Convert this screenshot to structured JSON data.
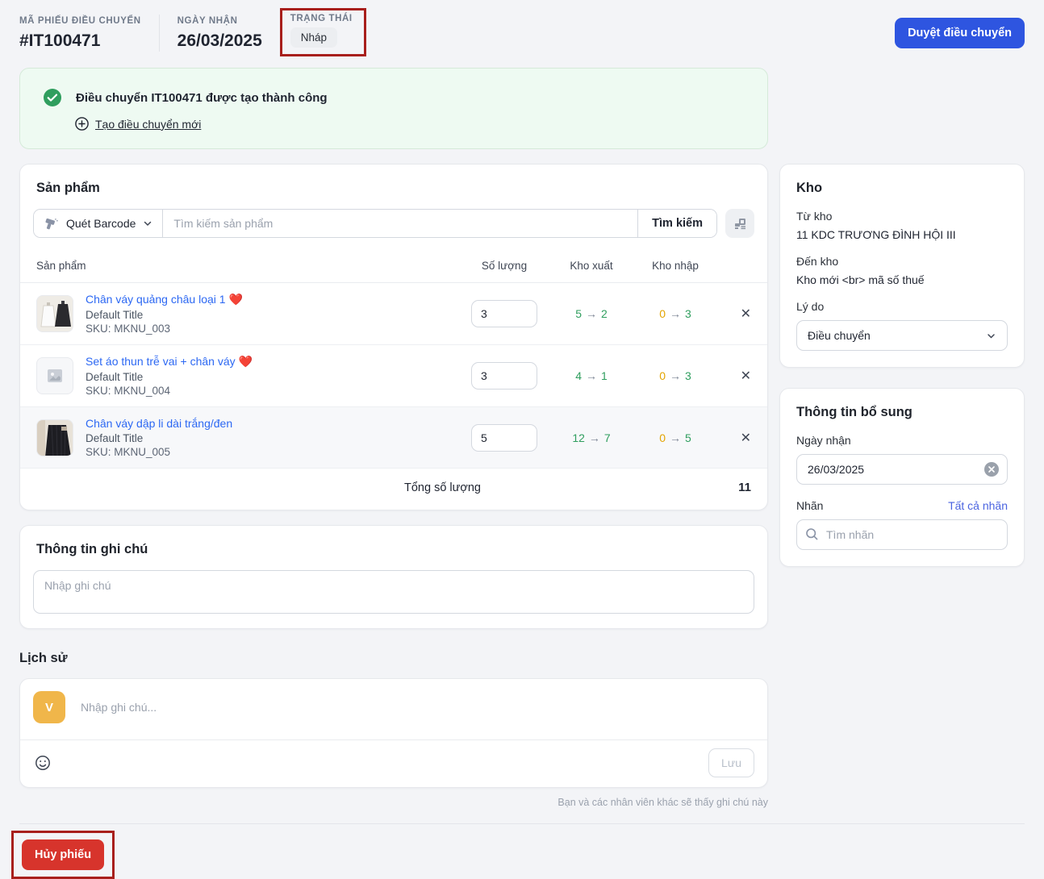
{
  "header": {
    "code_label": "MÃ PHIẾU ĐIỀU CHUYỂN",
    "code_value": "#IT100471",
    "date_label": "NGÀY NHẬN",
    "date_value": "26/03/2025",
    "status_label": "TRẠNG THÁI",
    "status_value": "Nháp",
    "approve_button": "Duyệt điều chuyển"
  },
  "banner": {
    "title": "Điều chuyển IT100471 được tạo thành công",
    "link": "Tạo điều chuyển mới"
  },
  "products": {
    "title": "Sản phẩm",
    "barcode_button": "Quét Barcode",
    "search_placeholder": "Tìm kiếm sản phẩm",
    "search_button": "Tìm kiếm",
    "columns": {
      "product": "Sản phẩm",
      "quantity": "Số lượng",
      "out_stock": "Kho xuất",
      "in_stock": "Kho nhập"
    },
    "rows": [
      {
        "name": "Chân váy quảng châu loại 1",
        "heart": "❤️",
        "variant": "Default Title",
        "sku": "SKU: MKNU_003",
        "qty": "3",
        "out_from": "5",
        "out_to": "2",
        "in_from": "0",
        "in_to": "3"
      },
      {
        "name": "Set áo thun trễ vai + chân váy",
        "heart": "❤️",
        "variant": "Default Title",
        "sku": "SKU: MKNU_004",
        "qty": "3",
        "out_from": "4",
        "out_to": "1",
        "in_from": "0",
        "in_to": "3"
      },
      {
        "name": "Chân váy dập li dài trắng/đen",
        "heart": "",
        "variant": "Default Title",
        "sku": "SKU: MKNU_005",
        "qty": "5",
        "out_from": "12",
        "out_to": "7",
        "in_from": "0",
        "in_to": "5"
      }
    ],
    "total_label": "Tổng số lượng",
    "total_value": "11"
  },
  "warehouse": {
    "title": "Kho",
    "from_label": "Từ kho",
    "from_value": "11 KDC TRƯƠNG ĐÌNH HỘI III",
    "to_label": "Đến kho",
    "to_value": "Kho mới <br> mã số thuế",
    "reason_label": "Lý do",
    "reason_value": "Điều chuyển"
  },
  "extra_info": {
    "title": "Thông tin bổ sung",
    "date_label": "Ngày nhận",
    "date_value": "26/03/2025",
    "tags_label": "Nhãn",
    "all_tags_link": "Tất cả nhãn",
    "tags_placeholder": "Tìm nhãn"
  },
  "notes": {
    "title": "Thông tin ghi chú",
    "placeholder": "Nhập ghi chú"
  },
  "history": {
    "title": "Lịch sử",
    "avatar_initial": "V",
    "input_placeholder": "Nhập ghi chú...",
    "save_button": "Lưu",
    "caption": "Bạn và các nhân viên khác sẽ thấy ghi chú này"
  },
  "footer": {
    "cancel_button": "Hủy phiếu"
  },
  "icons": {
    "arrow_right": "→",
    "close": "✕"
  },
  "colors": {
    "accent_blue": "#2e55e0",
    "link_blue": "#2c68f3",
    "success_green": "#2f9e5e",
    "warning_amber": "#e3a400",
    "danger_red": "#d7342c",
    "annotation_red": "#a81f1c",
    "avatar_yellow": "#f0b64a"
  }
}
